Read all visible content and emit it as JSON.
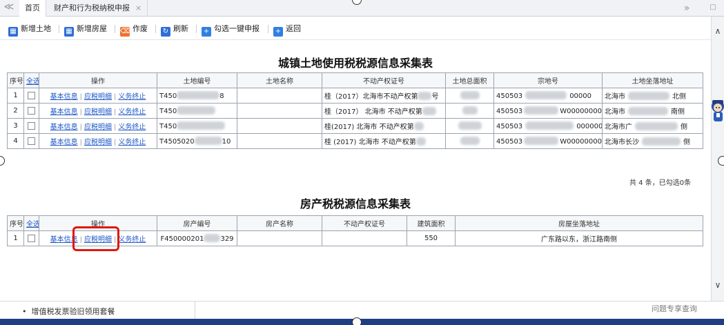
{
  "tabs": {
    "nav_prev": "≪",
    "nav_next": "»",
    "home": "首页",
    "active_tab": "财产和行为税纳税申报",
    "close": "×"
  },
  "toolbar": {
    "add_land": "新增土地",
    "add_house": "新增房屋",
    "void": "作废",
    "refresh": "刷新",
    "batch_declare": "勾选一键申报",
    "back": "返回"
  },
  "land": {
    "title": "城镇土地使用税税源信息采集表",
    "headers": [
      "序号",
      "全选",
      "操作",
      "土地编号",
      "土地名称",
      "不动产权证号",
      "土地总面积",
      "宗地号",
      "土地坐落地址"
    ],
    "actions": {
      "basic": "基本信息",
      "tax": "应税明细",
      "terminate": "义务终止"
    },
    "rows": [
      {
        "no": "1",
        "code": "T450",
        "code_tail": "8",
        "cert": "桂（2017）北海市不动产权第",
        "cert_tail": "号",
        "parcel": "450503",
        "parcel_tail": "00000",
        "addr": "北海市",
        "addr_tail": "北侧"
      },
      {
        "no": "2",
        "code": "T450",
        "code_tail": "",
        "cert": "桂（2017） 北海市 不动产权第",
        "cert_tail": "",
        "parcel": "450503",
        "parcel_tail": "W00000000",
        "addr": "北海市",
        "addr_tail": "南侧"
      },
      {
        "no": "3",
        "code": "T450",
        "code_tail": "",
        "cert": "桂(2017) 北海市 不动产权第",
        "cert_tail": "",
        "parcel": "450503",
        "parcel_tail": "0000000",
        "addr": "北海市广",
        "addr_tail": "侧"
      },
      {
        "no": "4",
        "code": "T4505020",
        "code_tail": "10",
        "cert": "桂 (2017) 北海市 不动产权第",
        "cert_tail": "",
        "parcel": "450503",
        "parcel_tail": "W00000000",
        "addr": "北海市长沙",
        "addr_tail": "侧"
      }
    ],
    "summary": "共 4 条，已勾选0条"
  },
  "house": {
    "title": "房产税税源信息采集表",
    "headers": [
      "序号",
      "全选",
      "操作",
      "房产编号",
      "房产名称",
      "不动产权证号",
      "建筑面积",
      "房屋坐落地址"
    ],
    "rows": [
      {
        "no": "1",
        "code": "F450000201",
        "code_tail": "329",
        "area": "550",
        "addr": "广东路以东，浙江路南侧"
      }
    ]
  },
  "bottom": {
    "item": "增值税发票验旧领用套餐",
    "right": "问题专享查询"
  },
  "scroll": {
    "up": "∧",
    "down": "∨"
  },
  "colors": {
    "accent": "#1a55c7",
    "highlight": "#e0160c",
    "strip": "#1f3f82"
  }
}
